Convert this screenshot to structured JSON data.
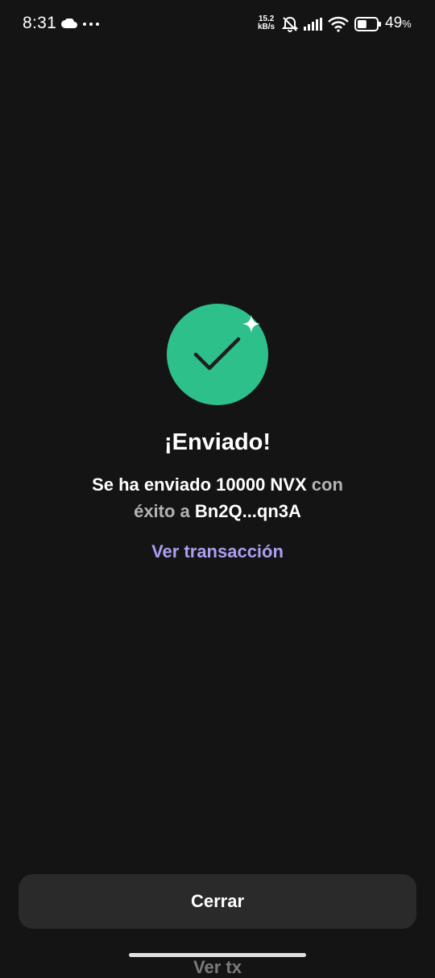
{
  "status_bar": {
    "time": "8:31",
    "net_speed_value": "15.2",
    "net_speed_unit": "kB/s",
    "battery_percent": "49",
    "battery_symbol": "%",
    "battery_level": 0.49,
    "icons": [
      "cloud-icon",
      "more-dots-icon",
      "bell-muted-icon",
      "signal-icon",
      "wifi-icon",
      "battery-icon"
    ]
  },
  "success": {
    "title": "¡Enviado!",
    "message_main": "Se ha enviado 10000 NVX",
    "message_muted": "con",
    "message_line2_muted": "éxito a",
    "recipient": "Bn2Q...qn3A",
    "link_label": "Ver transacción"
  },
  "footer": {
    "close_label": "Cerrar",
    "peek_label": "Ver tx"
  },
  "colors": {
    "background": "#141414",
    "success_green": "#2ec08b",
    "link_purple": "#ab9ff2",
    "button_bg": "#2a2a2a"
  }
}
